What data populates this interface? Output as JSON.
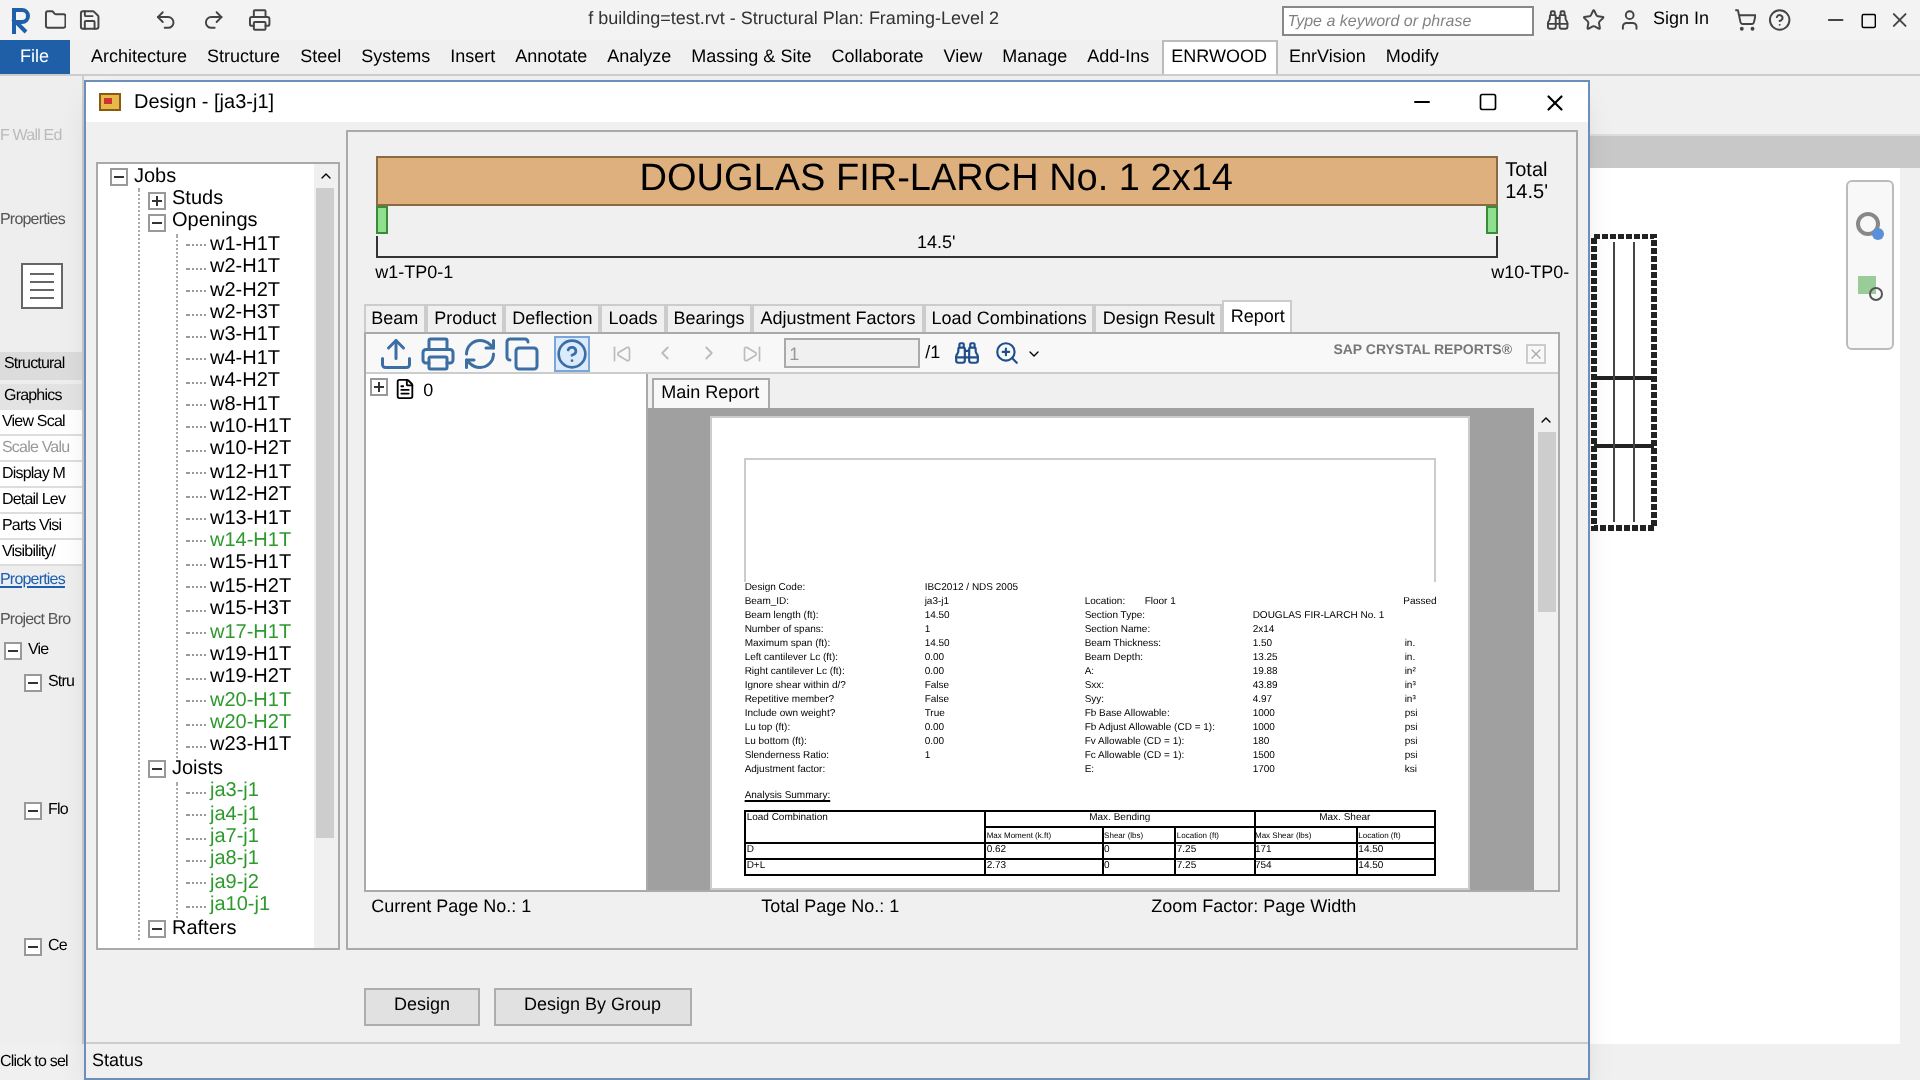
{
  "app": {
    "title": "f building=test.rvt - Structural Plan: Framing-Level 2",
    "search": {
      "placeholder": "Type a keyword or phrase"
    },
    "sign_in": "Sign In",
    "ribbon_tabs": [
      {
        "label": "File",
        "kind": "file",
        "selected": false
      },
      {
        "label": "Architecture",
        "kind": "tab",
        "selected": false
      },
      {
        "label": "Structure",
        "kind": "tab",
        "selected": false
      },
      {
        "label": "Steel",
        "kind": "tab",
        "selected": false
      },
      {
        "label": "Systems",
        "kind": "tab",
        "selected": false
      },
      {
        "label": "Insert",
        "kind": "tab",
        "selected": false
      },
      {
        "label": "Annotate",
        "kind": "tab",
        "selected": false
      },
      {
        "label": "Analyze",
        "kind": "tab",
        "selected": false
      },
      {
        "label": "Massing & Site",
        "kind": "tab",
        "selected": false
      },
      {
        "label": "Collaborate",
        "kind": "tab",
        "selected": false
      },
      {
        "label": "View",
        "kind": "tab",
        "selected": false
      },
      {
        "label": "Manage",
        "kind": "tab",
        "selected": false
      },
      {
        "label": "Add-Ins",
        "kind": "tab",
        "selected": false
      },
      {
        "label": "ENRWOOD",
        "kind": "tab",
        "selected": true
      },
      {
        "label": "EnrVision",
        "kind": "tab",
        "selected": false
      },
      {
        "label": "Modify",
        "kind": "tab",
        "selected": false
      }
    ],
    "ribbon_label": "F Wall Ed",
    "properties": {
      "title": "Properties",
      "type": "Structural",
      "section": "Graphics",
      "rows": [
        {
          "label": "View Scal",
          "disabled": false
        },
        {
          "label": "Scale Valu",
          "disabled": true
        },
        {
          "label": "Display M",
          "disabled": false
        },
        {
          "label": "Detail Lev",
          "disabled": false
        },
        {
          "label": "Parts Visi",
          "disabled": false
        },
        {
          "label": "Visibility/",
          "disabled": false
        }
      ],
      "link": "Properties"
    },
    "browser": {
      "title": "Project Bro",
      "items": [
        {
          "label": "Vie",
          "expanded": true,
          "children": [
            {
              "label": "Stru",
              "expanded": true
            },
            {
              "label": "Flo",
              "expanded": true
            },
            {
              "label": "Ce",
              "expanded": true
            }
          ]
        }
      ]
    },
    "status": "Click to sel"
  },
  "dialog": {
    "title": "Design - [ja3-j1]",
    "tree": [
      {
        "label": "Jobs",
        "expanded": true,
        "children": [
          {
            "label": "Studs",
            "expanded": false
          },
          {
            "label": "Openings",
            "expanded": true,
            "children": [
              {
                "label": "w1-H1T",
                "color": "#000000"
              },
              {
                "label": "w2-H1T",
                "color": "#000000"
              },
              {
                "label": "w2-H2T",
                "color": "#000000"
              },
              {
                "label": "w2-H3T",
                "color": "#000000"
              },
              {
                "label": "w3-H1T",
                "color": "#000000"
              },
              {
                "label": "w4-H1T",
                "color": "#000000"
              },
              {
                "label": "w4-H2T",
                "color": "#000000"
              },
              {
                "label": "w8-H1T",
                "color": "#000000"
              },
              {
                "label": "w10-H1T",
                "color": "#000000"
              },
              {
                "label": "w10-H2T",
                "color": "#000000"
              },
              {
                "label": "w12-H1T",
                "color": "#000000"
              },
              {
                "label": "w12-H2T",
                "color": "#000000"
              },
              {
                "label": "w13-H1T",
                "color": "#000000"
              },
              {
                "label": "w14-H1T",
                "color": "#2e9a2e"
              },
              {
                "label": "w15-H1T",
                "color": "#000000"
              },
              {
                "label": "w15-H2T",
                "color": "#000000"
              },
              {
                "label": "w15-H3T",
                "color": "#000000"
              },
              {
                "label": "w17-H1T",
                "color": "#2e9a2e"
              },
              {
                "label": "w19-H1T",
                "color": "#000000"
              },
              {
                "label": "w19-H2T",
                "color": "#000000"
              },
              {
                "label": "w20-H1T",
                "color": "#2e9a2e"
              },
              {
                "label": "w20-H2T",
                "color": "#2e9a2e"
              },
              {
                "label": "w23-H1T",
                "color": "#000000"
              }
            ]
          },
          {
            "label": "Joists",
            "expanded": true,
            "children": [
              {
                "label": "ja3-j1",
                "color": "#2e9a2e"
              },
              {
                "label": "ja4-j1",
                "color": "#2e9a2e"
              },
              {
                "label": "ja7-j1",
                "color": "#2e9a2e"
              },
              {
                "label": "ja8-j1",
                "color": "#2e9a2e"
              },
              {
                "label": "ja9-j2",
                "color": "#2e9a2e"
              },
              {
                "label": "ja10-j1",
                "color": "#2e9a2e"
              }
            ]
          },
          {
            "label": "Rafters",
            "expanded": true
          }
        ]
      }
    ],
    "beam": {
      "name": "DOUGLAS FIR-LARCH No. 1 2x14",
      "total_label": "Total",
      "total_value": "14.5'",
      "span": "14.5'",
      "left_support": "w1-TP0-1",
      "right_support": "w10-TP0-"
    },
    "tabs": [
      {
        "label": "Beam",
        "selected": false
      },
      {
        "label": "Product",
        "selected": false
      },
      {
        "label": "Deflection",
        "selected": false
      },
      {
        "label": "Loads",
        "selected": false
      },
      {
        "label": "Bearings",
        "selected": false
      },
      {
        "label": "Adjustment Factors",
        "selected": false
      },
      {
        "label": "Load Combinations",
        "selected": false
      },
      {
        "label": "Design Result",
        "selected": false
      },
      {
        "label": "Report",
        "selected": true
      }
    ],
    "viewer": {
      "page_field": "1",
      "page_count": "/1",
      "brand": "SAP CRYSTAL REPORTS®",
      "group_tree": "0",
      "report_tab": "Main Report",
      "report": {
        "left": [
          {
            "label": "Design Code:",
            "value": "IBC2012 / NDS 2005"
          },
          {
            "label": "Beam_ID:",
            "value": "ja3-j1"
          },
          {
            "label": "Beam length (ft):",
            "value": "14.50"
          },
          {
            "label": "Number of spans:",
            "value": "1"
          },
          {
            "label": "Maximum span (ft):",
            "value": "14.50"
          },
          {
            "label": "Left cantilever Lc (ft):",
            "value": "0.00"
          },
          {
            "label": "Right cantilever Lc (ft):",
            "value": "0.00"
          },
          {
            "label": "Ignore shear within d/?",
            "value": "False"
          },
          {
            "label": "Repetitive member?",
            "value": "False"
          },
          {
            "label": "Include own weight?",
            "value": "True"
          },
          {
            "label": "Lu top (ft):",
            "value": "0.00"
          },
          {
            "label": "Lu bottom (ft):",
            "value": "0.00"
          },
          {
            "label": "Slenderness Ratio:",
            "value": "1"
          },
          {
            "label": "Adjustment factor:"
          }
        ],
        "location_label": "Location:",
        "location": "Floor 1",
        "result": "Passed",
        "right": [
          {
            "label": "Section Type:",
            "value": "DOUGLAS FIR-LARCH No. 1"
          },
          {
            "label": "Section Name:",
            "value": "2x14"
          },
          {
            "label": "Beam Thickness:",
            "value": "1.50",
            "unit": "in."
          },
          {
            "label": "Beam Depth:",
            "value": "13.25",
            "unit": "in."
          },
          {
            "label": "A:",
            "value": "19.88",
            "unit": "in²"
          },
          {
            "label": "Sxx:",
            "value": "43.89",
            "unit": "in³"
          },
          {
            "label": "Syy:",
            "value": "4.97",
            "unit": "in³"
          },
          {
            "label": "Fb Base Allowable:",
            "value": "1000",
            "unit": "psi"
          },
          {
            "label": "Fb Adjust Allowable (CD = 1):",
            "value": "1000",
            "unit": "psi"
          },
          {
            "label": "Fv Allowable (CD = 1):",
            "value": "180",
            "unit": "psi"
          },
          {
            "label": "Fc Allowable (CD = 1):",
            "value": "1500",
            "unit": "psi"
          },
          {
            "label": "E:",
            "value": "1700",
            "unit": "ksi"
          }
        ],
        "summary_title": "Analysis Summary:",
        "table": {
          "first_header": "Load Combination",
          "groups": [
            "Max. Bending",
            "Max. Shear"
          ],
          "columns": [
            "",
            "Max Moment (k.ft)",
            "Shear (lbs)",
            "Location (ft)",
            "Max Shear (lbs)",
            "Location (ft)"
          ],
          "rows": [
            [
              "D",
              "0.62",
              "0",
              "7.25",
              "171",
              "14.50"
            ],
            [
              "D+L",
              "2.73",
              "0",
              "7.25",
              "754",
              "14.50"
            ]
          ]
        }
      }
    },
    "status": {
      "current": "Current Page No.: 1",
      "total": "Total Page No.: 1",
      "zoom": "Zoom Factor: Page Width"
    },
    "buttons": [
      "Design",
      "Design By Group"
    ],
    "status_bar": "Status"
  }
}
